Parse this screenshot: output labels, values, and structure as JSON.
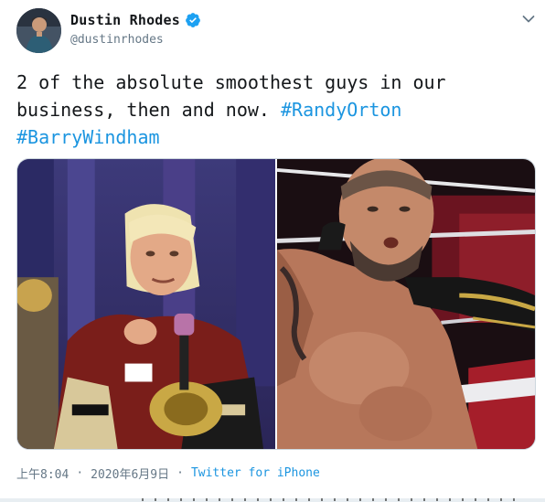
{
  "author": {
    "display_name": "Dustin Rhodes",
    "handle": "@dustinrhodes",
    "verified": true,
    "avatar_icon": "user-avatar"
  },
  "tweet": {
    "text_line1": "2 of the absolute smoothest guys in our",
    "text_line2_plain": "business, then and now. ",
    "hashtag1": "#RandyOrton",
    "hashtag2": "#BarryWindham"
  },
  "media": {
    "count": 2
  },
  "meta": {
    "time": "上午8:04",
    "separator": "·",
    "date": "2020年6月9日",
    "source": "Twitter for iPhone"
  },
  "colors": {
    "link": "#1b95e0",
    "text": "#14171a",
    "muted": "#657786",
    "verified": "#1da1f2"
  }
}
